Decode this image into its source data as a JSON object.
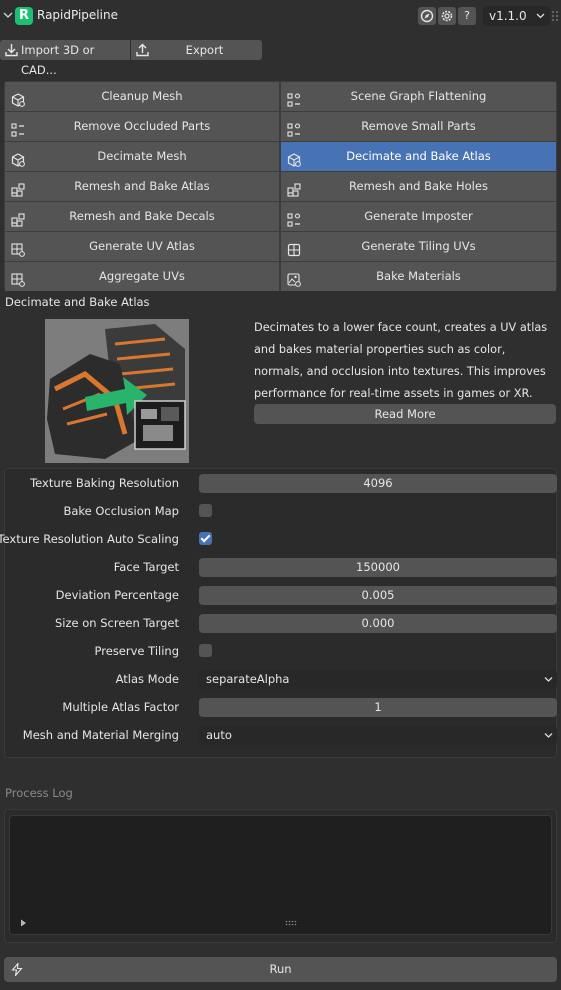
{
  "header": {
    "title": "RapidPipeline",
    "icons": [
      "compass-icon",
      "gear-icon",
      "help-icon"
    ],
    "help_label": "?",
    "version": "v1.1.0"
  },
  "toolbar": {
    "import_label": "Import 3D or CAD...",
    "export_label": "Export"
  },
  "tools": [
    {
      "label": "Cleanup Mesh",
      "icon": "cube-gear-icon"
    },
    {
      "label": "Scene Graph Flattening",
      "icon": "hierarchy-icon"
    },
    {
      "label": "Remove Occluded Parts",
      "icon": "hierarchy-remove-icon"
    },
    {
      "label": "Remove Small Parts",
      "icon": "hierarchy-icon"
    },
    {
      "label": "Decimate Mesh",
      "icon": "cube-gear-icon"
    },
    {
      "label": "Decimate and Bake Atlas",
      "icon": "cube-gear-icon",
      "active": true
    },
    {
      "label": "Remesh and Bake Atlas",
      "icon": "blocks-icon"
    },
    {
      "label": "Remesh and Bake Holes",
      "icon": "blocks-icon"
    },
    {
      "label": "Remesh and Bake Decals",
      "icon": "blocks-icon"
    },
    {
      "label": "Generate Imposter",
      "icon": "hierarchy-icon"
    },
    {
      "label": "Generate UV Atlas",
      "icon": "grid-gear-icon"
    },
    {
      "label": "Generate Tiling UVs",
      "icon": "grid-icon"
    },
    {
      "label": "Aggregate UVs",
      "icon": "grid-gear-icon"
    },
    {
      "label": "Bake Materials",
      "icon": "image-gear-icon"
    }
  ],
  "selected": {
    "title": "Decimate and Bake Atlas",
    "description": "Decimates to a lower face count, creates a UV atlas and bakes material properties such as color, normals, and occlusion into textures. This improves performance for real-time assets in games or XR.",
    "read_more": "Read More"
  },
  "settings": {
    "texture_baking_resolution": {
      "label": "Texture Baking Resolution",
      "value": "4096"
    },
    "bake_occlusion_map": {
      "label": "Bake Occlusion Map",
      "checked": false
    },
    "texture_resolution_auto_scaling": {
      "label": "Texture Resolution Auto Scaling",
      "checked": true
    },
    "face_target": {
      "label": "Face Target",
      "value": "150000"
    },
    "deviation_percentage": {
      "label": "Deviation Percentage",
      "value": "0.005"
    },
    "size_on_screen_target": {
      "label": "Size on Screen Target",
      "value": "0.000"
    },
    "preserve_tiling": {
      "label": "Preserve Tiling",
      "checked": false
    },
    "atlas_mode": {
      "label": "Atlas Mode",
      "value": "separateAlpha"
    },
    "multiple_atlas_factor": {
      "label": "Multiple Atlas Factor",
      "value": "1"
    },
    "mesh_and_material_merging": {
      "label": "Mesh and Material Merging",
      "value": "auto"
    }
  },
  "log": {
    "title": "Process Log"
  },
  "run": {
    "label": "Run"
  },
  "colors": {
    "accent": "#4772b3",
    "button": "#545454",
    "background": "#2f2f2f",
    "logo": "#1fbf73"
  }
}
